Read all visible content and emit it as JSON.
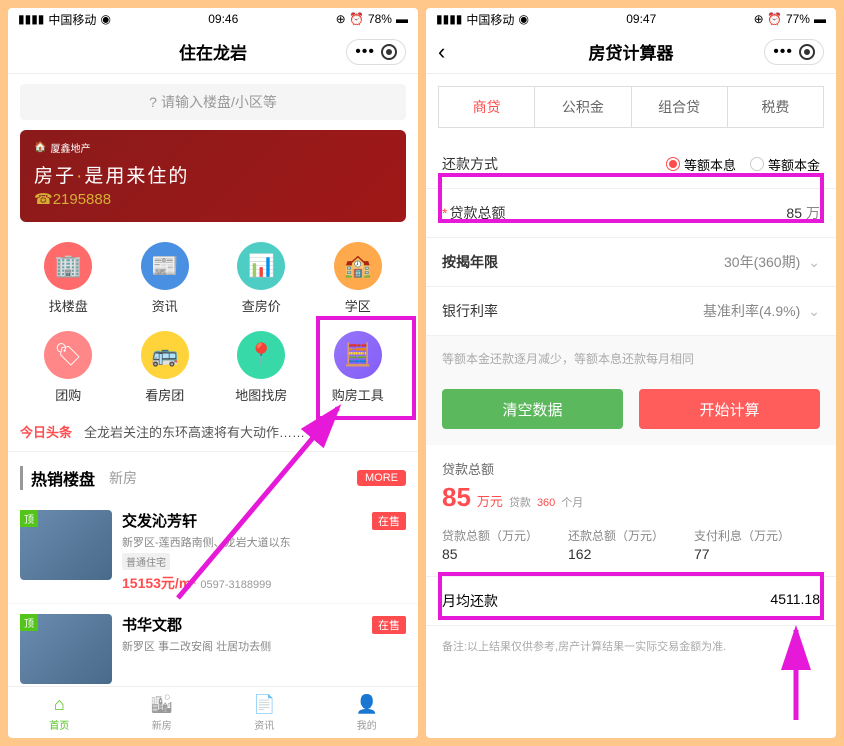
{
  "left": {
    "status": {
      "carrier": "中国移动",
      "time": "09:46",
      "battery": "78%"
    },
    "title": "住在龙岩",
    "search_placeholder": "请输入楼盘/小区等",
    "banner": {
      "logo": "厦鑫地产",
      "title_a": "房子",
      "title_b": "是用来住的",
      "phone": "2195888"
    },
    "grid": [
      {
        "label": "找楼盘"
      },
      {
        "label": "资讯"
      },
      {
        "label": "查房价"
      },
      {
        "label": "学区"
      },
      {
        "label": "团购"
      },
      {
        "label": "看房团"
      },
      {
        "label": "地图找房"
      },
      {
        "label": "购房工具"
      }
    ],
    "headline": {
      "tag": "今日头条",
      "text": "全龙岩关注的东环高速将有大动作……"
    },
    "section": {
      "title": "热销楼盘",
      "sub": "新房",
      "more": "MORE"
    },
    "listings": [
      {
        "badge": "顶",
        "name": "交发沁芳轩",
        "sub": "新罗区-莲西路南侧、龙岩大道以东",
        "tag": "普通住宅",
        "price": "15153元/m²",
        "phone": "0597-3188999",
        "sale": "在售"
      },
      {
        "badge": "顶",
        "name": "书华文郡",
        "sub": "新罗区 事二改安阁 壮居功去侧",
        "sale": "在售"
      }
    ],
    "tabs": [
      {
        "label": "首页"
      },
      {
        "label": "新房"
      },
      {
        "label": "资讯"
      },
      {
        "label": "我的"
      }
    ]
  },
  "right": {
    "status": {
      "carrier": "中国移动",
      "time": "09:47",
      "battery": "77%"
    },
    "title": "房贷计算器",
    "tabs": [
      "商贷",
      "公积金",
      "组合贷",
      "税费"
    ],
    "form": {
      "repay_label": "还款方式",
      "repay_options": [
        "等额本息",
        "等额本金"
      ],
      "amount_label": "贷款总额",
      "amount_value": "85",
      "amount_unit": "万",
      "years_label": "按揭年限",
      "years_value": "30年(360期)",
      "rate_label": "银行利率",
      "rate_value": "基准利率(4.9%)"
    },
    "hint": "等额本金还款逐月减少，等额本息还款每月相同",
    "btn_clear": "清空数据",
    "btn_calc": "开始计算",
    "result": {
      "total_label": "贷款总额",
      "amount": "85",
      "unit": "万元",
      "loan_tag": "贷款",
      "months": "360",
      "months_unit": "个月",
      "cols": [
        {
          "label": "贷款总额（万元）",
          "value": "85"
        },
        {
          "label": "还款总额（万元）",
          "value": "162"
        },
        {
          "label": "支付利息（万元）",
          "value": "77"
        }
      ],
      "monthly_label": "月均还款",
      "monthly_value": "4511.18"
    },
    "note": "备注:以上结果仅供参考,房产计算结果一实际交易金额为准."
  }
}
